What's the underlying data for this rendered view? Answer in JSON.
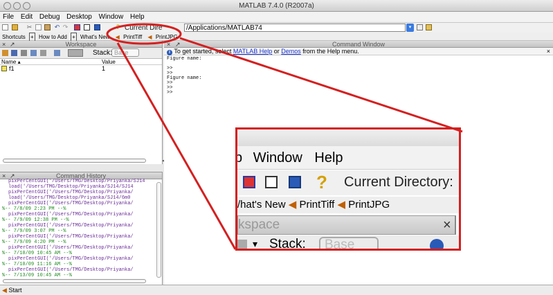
{
  "window": {
    "title": "MATLAB  7.4.0 (R2007a)"
  },
  "menu": [
    "File",
    "Edit",
    "Debug",
    "Desktop",
    "Window",
    "Help"
  ],
  "toolbar": {
    "current_dir_label": "Current Directory:",
    "current_dir_value": "/Applications/MATLAB74",
    "current_dir_label_partial": "Current Dire"
  },
  "shortcuts": {
    "label": "Shortcuts",
    "how_to_add": "How to Add",
    "whats_new": "What's New",
    "print_tiff": "PrintTiff",
    "print_jpg": "PrintJPG"
  },
  "workspace": {
    "title": "Workspace",
    "stack_label": "Stack:",
    "stack_value": "Base",
    "columns": {
      "name": "Name ▴",
      "value": "Value"
    },
    "rows": [
      {
        "name": "f1",
        "value": "1"
      }
    ]
  },
  "command_history": {
    "title": "Command History",
    "lines": [
      {
        "type": "cmd",
        "text": "pixPerCentGUI('/Users/TMG/Desktop/Priyanka/SJ14"
      },
      {
        "type": "cmd",
        "text": "load('/Users/TMG/Desktop/Priyanka/SJ14/SJ14"
      },
      {
        "type": "cmd",
        "text": "pixPerCentGUI('/Users/TMG/Desktop/Priyanka/"
      },
      {
        "type": "cmd",
        "text": "load('/Users/TMG/Desktop/Priyanka/SJ14/6m0"
      },
      {
        "type": "cmd",
        "text": "pixPerCentGUI('/Users/TMG/Desktop/Priyanka/"
      },
      {
        "type": "session",
        "text": "%-- 7/8/09  2:23 PM --%"
      },
      {
        "type": "cmd",
        "text": "pixPerCentGUI('/Users/TMG/Desktop/Priyanka/"
      },
      {
        "type": "session",
        "text": "%-- 7/9/09 12:38 PM --%"
      },
      {
        "type": "cmd",
        "text": "pixPerCentGUI('/Users/TMG/Desktop/Priyanka/"
      },
      {
        "type": "session",
        "text": "%-- 7/9/09  3:07 PM --%"
      },
      {
        "type": "cmd",
        "text": "pixPerCentGUI('/Users/TMG/Desktop/Priyanka/"
      },
      {
        "type": "session",
        "text": "%-- 7/9/09  4:20 PM --%"
      },
      {
        "type": "cmd",
        "text": "pixPerCentGUI('/Users/TMG/Desktop/Priyanka/"
      },
      {
        "type": "session",
        "text": "%-- 7/10/09 10:45 AM --%"
      },
      {
        "type": "cmd",
        "text": "pixPerCentGUI('/Users/TMG/Desktop/Priyanka/"
      },
      {
        "type": "session",
        "text": "%-- 7/10/09 11:16 AM --%"
      },
      {
        "type": "cmd",
        "text": "pixPerCentGUI('/Users/TMG/Desktop/Priyanka/"
      },
      {
        "type": "session",
        "text": "%-- 7/13/09 10:45 AM --%"
      }
    ]
  },
  "command_window": {
    "title": "Command Window",
    "info_prefix": "To get started, select ",
    "info_link1": "MATLAB Help",
    "info_mid": " or ",
    "info_link2": "Demos",
    "info_suffix": " from the Help menu.",
    "lines": [
      "Figure name:",
      "",
      ">>",
      ">>",
      "Figure name:",
      ">>",
      ">>",
      ">>"
    ]
  },
  "zoom": {
    "menu_partial": "p",
    "menu_window": "Window",
    "menu_help": "Help",
    "whats_new_partial": "/hat's New",
    "workspace_partial": "kspace",
    "stack_label": "Stack:",
    "stack_value": "Base",
    "close_glyph": "×"
  },
  "start": {
    "label": "Start"
  },
  "colors": {
    "highlight": "#d42020",
    "link": "#1a33cc",
    "history_cmd": "#6a2c98",
    "history_session": "#1e8a1e"
  }
}
